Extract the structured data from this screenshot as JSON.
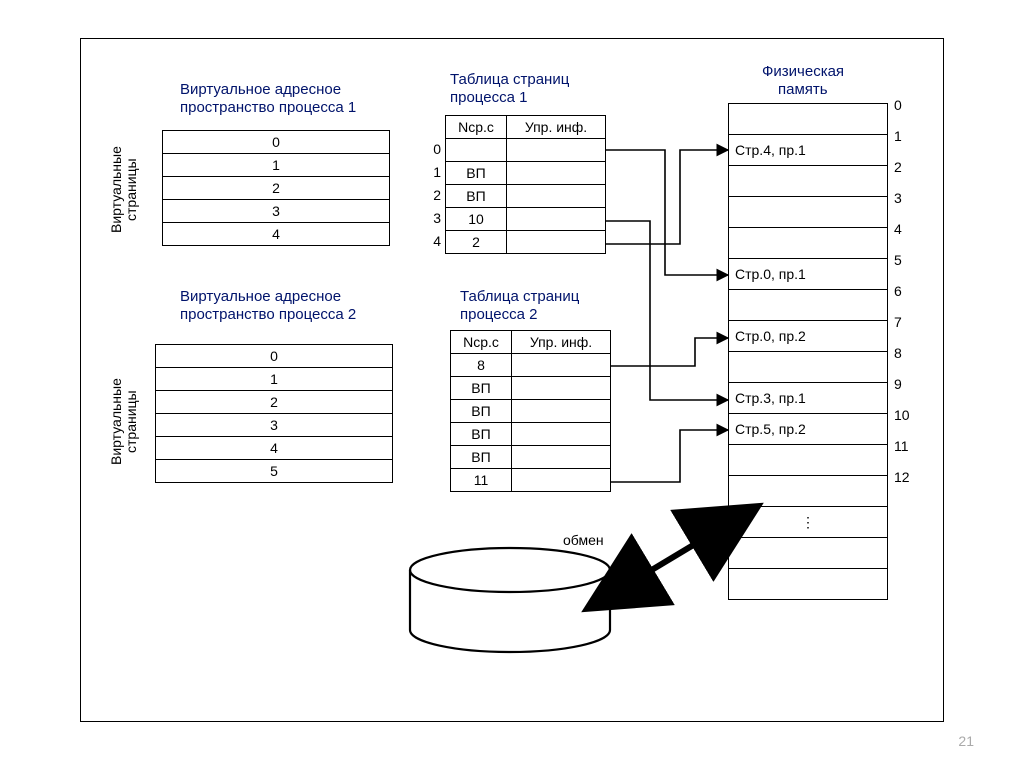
{
  "titles": {
    "vspace1_l1": "Виртуальное адресное",
    "vspace1_l2": "пространство процесса 1",
    "vspace2_l1": "Виртуальное адресное",
    "vspace2_l2": "пространство процесса 2",
    "pt1_l1": "Таблица страниц",
    "pt1_l2": "процесса 1",
    "pt2_l1": "Таблица страниц",
    "pt2_l2": "процесса 2",
    "phys_l1": "Физическая",
    "phys_l2": "память"
  },
  "sideLabels": {
    "v1_a": "Виртуальные",
    "v1_b": "страницы",
    "v2_a": "Виртуальные",
    "v2_b": "страницы"
  },
  "misc": {
    "swap": "обмен",
    "page_num": "21",
    "vdots": "⋮"
  },
  "headers": {
    "n_fr": "Nср.с",
    "ctrl": "Упр. инф."
  },
  "vpages1": [
    "0",
    "1",
    "2",
    "3",
    "4"
  ],
  "vpages2": [
    "0",
    "1",
    "2",
    "3",
    "4",
    "5"
  ],
  "pt1_idx": [
    "0",
    "1",
    "2",
    "3",
    "4"
  ],
  "pt1": [
    {
      "n": "",
      "c": ""
    },
    {
      "n": "ВП",
      "c": ""
    },
    {
      "n": "ВП",
      "c": ""
    },
    {
      "n": "10",
      "c": ""
    },
    {
      "n": "2",
      "c": ""
    }
  ],
  "pt2": [
    {
      "n": "8",
      "c": ""
    },
    {
      "n": "ВП",
      "c": ""
    },
    {
      "n": "ВП",
      "c": ""
    },
    {
      "n": "ВП",
      "c": ""
    },
    {
      "n": "ВП",
      "c": ""
    },
    {
      "n": "11",
      "c": ""
    }
  ],
  "phys_idx": [
    "0",
    "1",
    "2",
    "3",
    "4",
    "5",
    "6",
    "7",
    "8",
    "9",
    "10",
    "11",
    "12"
  ],
  "phys": [
    "",
    "Стр.4, пр.1",
    "",
    "",
    "",
    "Стр.0, пр.1",
    "",
    "Стр.0, пр.2",
    "",
    "Стр.3, пр.1",
    "Стр.5, пр.2",
    "",
    ""
  ]
}
